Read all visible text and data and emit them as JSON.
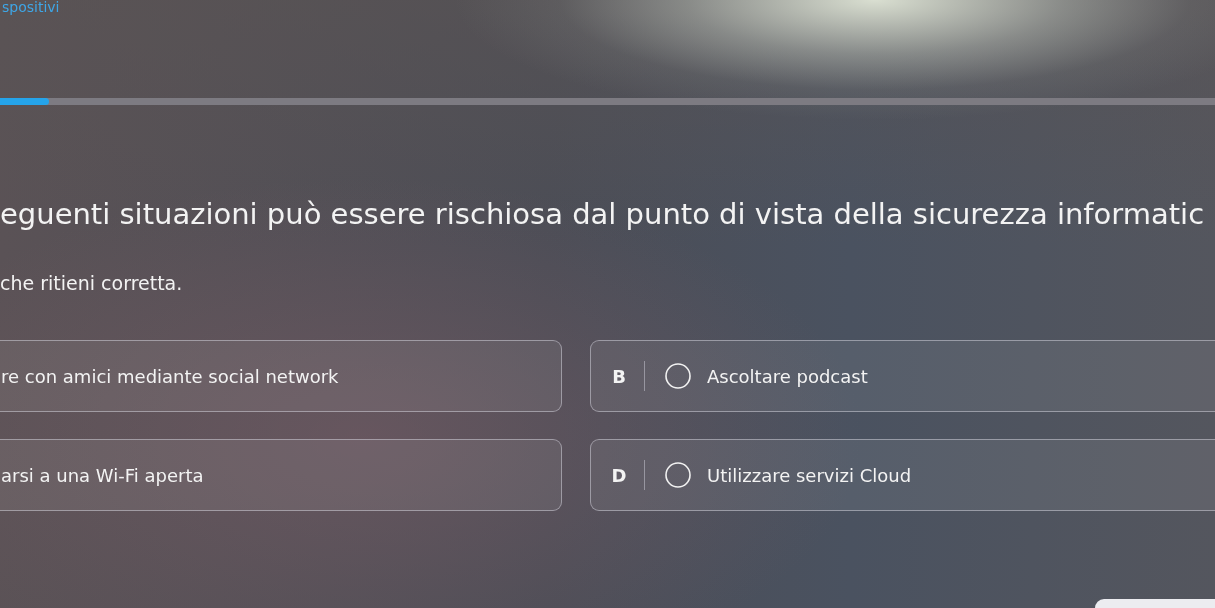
{
  "header": {
    "title": "spositivi"
  },
  "progress": {
    "level": 0.04
  },
  "question": {
    "text": "eguenti situazioni può essere rischiosa dal punto di vista della sicurezza informatic",
    "instruction": "che ritieni corretta."
  },
  "options": [
    {
      "text": "re con amici mediante social network"
    },
    {
      "letter": "B",
      "text": "Ascoltare podcast",
      "selected": false
    },
    {
      "text": "arsi a una Wi-Fi aperta"
    },
    {
      "letter": "D",
      "text": "Utilizzare servizi Cloud",
      "selected": false
    }
  ]
}
